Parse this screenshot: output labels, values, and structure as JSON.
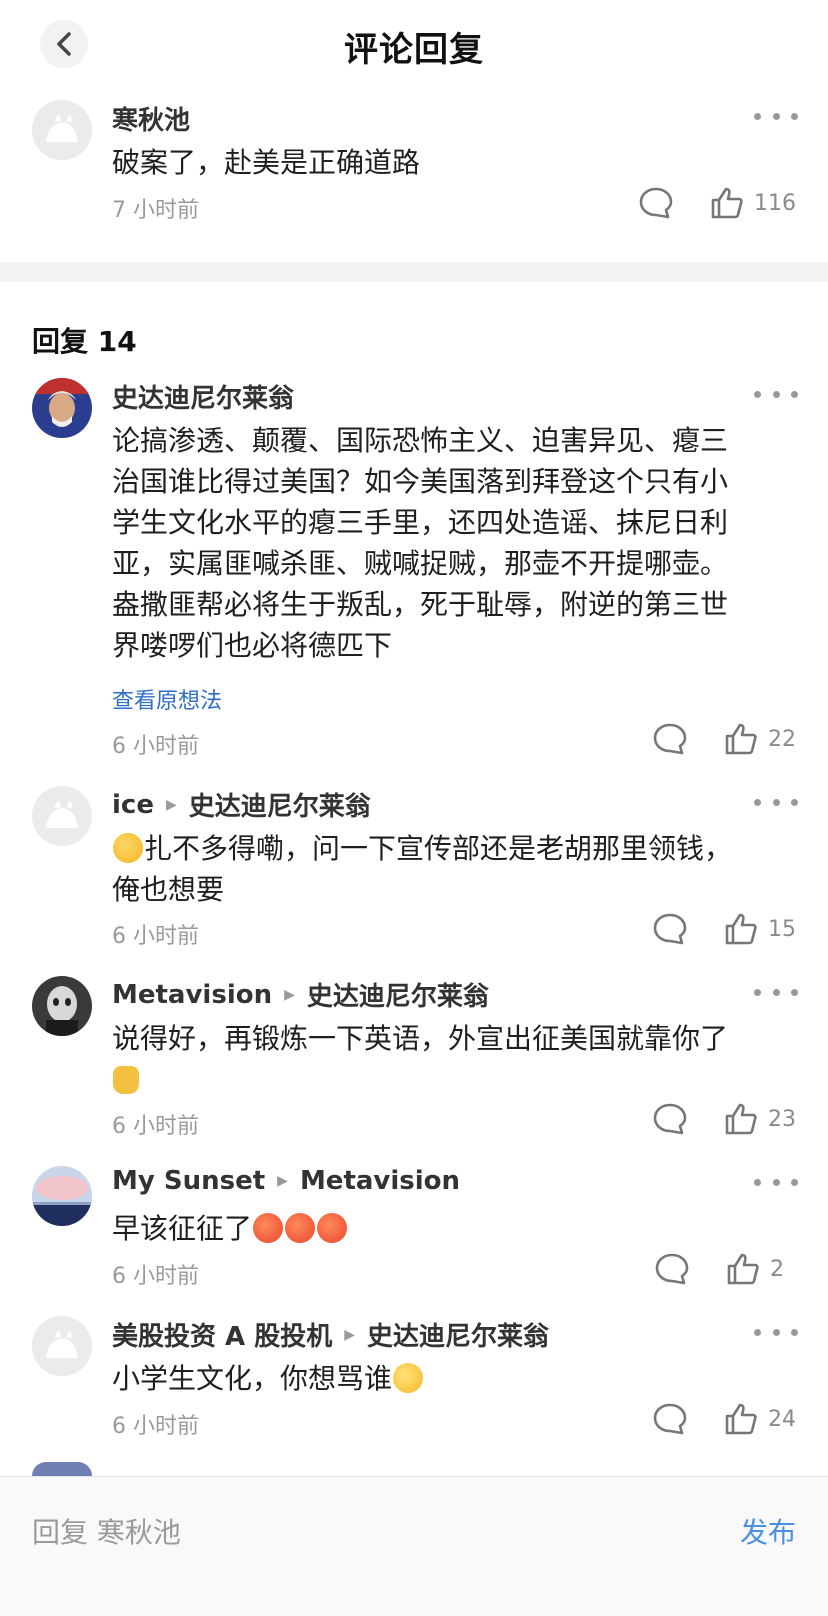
{
  "header": {
    "title": "评论回复",
    "back_icon": "chevron-left-icon"
  },
  "original_comment": {
    "author": "寒秋池",
    "text": "破案了，赴美是正确道路",
    "time": "7 小时前",
    "likes": "116"
  },
  "replies_section": {
    "title": "回复 14"
  },
  "replies": [
    {
      "author": "史达迪尼尔莱翁",
      "reply_to": "",
      "text_lines": [
        "论搞渗透、颠覆、国际恐怖主义、迫害异见、瘪三",
        "治国谁比得过美国？如今美国落到拜登这个只有小",
        "学生文化水平的瘪三手里，还四处造谣、抹尼日利",
        "亚，实属匪喊杀匪、贼喊捉贼，那壶不开提哪壶。",
        "盎撒匪帮必将生于叛乱，死于耻辱，附逆的第三世",
        "界喽啰们也必将德匹下"
      ],
      "view_original": "查看原想法",
      "time": "6 小时前",
      "likes": "22"
    },
    {
      "author": "ice",
      "reply_to": "史达迪尼尔莱翁",
      "text_line1": "扎不多得嘞，问一下宣传部还是老胡那里领钱，",
      "text_line2": "俺也想要",
      "time": "6 小时前",
      "likes": "15"
    },
    {
      "author": "Metavision",
      "reply_to": "史达迪尼尔莱翁",
      "text": "说得好，再锻炼一下英语，外宣出征美国就靠你了",
      "time": "6 小时前",
      "likes": "23"
    },
    {
      "author": "My Sunset",
      "reply_to": "Metavision",
      "text": "早该征征了",
      "time": "6 小时前",
      "likes": "2"
    },
    {
      "author": "美股投资 A 股投机",
      "reply_to": "史达迪尼尔莱翁",
      "text": "小学生文化，你想骂谁",
      "time": "6 小时前",
      "likes": "24"
    }
  ],
  "bottom_bar": {
    "reply_placeholder": "回复 寒秋池",
    "publish_label": "发布"
  },
  "colors": {
    "link_blue": "#2f6ec7",
    "publish_blue": "#4a8fe0",
    "muted_text": "#9a9a9a"
  }
}
